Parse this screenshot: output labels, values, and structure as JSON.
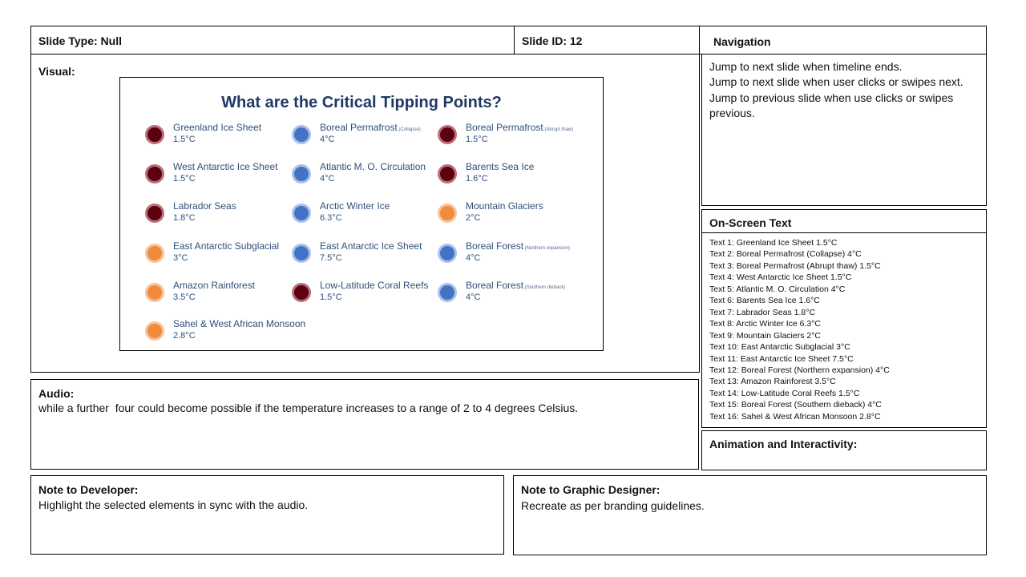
{
  "header": {
    "slide_type": "Slide Type: Null",
    "slide_id": "Slide ID: 12",
    "navigation_label": "Navigation"
  },
  "navigation": {
    "lines": [
      "Jump to next slide when timeline ends.",
      "Jump to next slide when user clicks or swipes next.",
      "Jump to previous slide when use clicks or swipes previous."
    ]
  },
  "visual": {
    "label": "Visual:",
    "title": "What are the Critical Tipping Points?",
    "items": [
      {
        "name": "Greenland Ice Sheet",
        "qualifier": "",
        "temp": "1.5°C",
        "color": "dark"
      },
      {
        "name": "Boreal Permafrost",
        "qualifier": "(Collapse)",
        "temp": "4°C",
        "color": "blue"
      },
      {
        "name": "Boreal Permafrost",
        "qualifier": "(Abrupt thaw)",
        "temp": "1.5°C",
        "color": "dark"
      },
      {
        "name": "West Antarctic Ice Sheet",
        "qualifier": "",
        "temp": "1.5°C",
        "color": "dark"
      },
      {
        "name": "Atlantic M. O. Circulation",
        "qualifier": "",
        "temp": "4°C",
        "color": "blue"
      },
      {
        "name": "Barents Sea Ice",
        "qualifier": "",
        "temp": "1.6°C",
        "color": "dark"
      },
      {
        "name": "Labrador Seas",
        "qualifier": "",
        "temp": "1.8°C",
        "color": "dark"
      },
      {
        "name": "Arctic Winter Ice",
        "qualifier": "",
        "temp": "6.3°C",
        "color": "blue"
      },
      {
        "name": "Mountain Glaciers",
        "qualifier": "",
        "temp": "2°C",
        "color": "orange"
      },
      {
        "name": "East Antarctic Subglacial",
        "qualifier": "",
        "temp": "3°C",
        "color": "orange"
      },
      {
        "name": "East Antarctic Ice Sheet",
        "qualifier": "",
        "temp": "7.5°C",
        "color": "blue"
      },
      {
        "name": "Boreal Forest",
        "qualifier": "(Northern expansion)",
        "temp": "4°C",
        "color": "blue"
      },
      {
        "name": "Amazon Rainforest",
        "qualifier": "",
        "temp": "3.5°C",
        "color": "orange"
      },
      {
        "name": "Low-Latitude Coral Reefs",
        "qualifier": "",
        "temp": "1.5°C",
        "color": "dark"
      },
      {
        "name": "Boreal Forest",
        "qualifier": "(Southern dieback)",
        "temp": "4°C",
        "color": "blue"
      },
      {
        "name": "Sahel & West African Monsoon",
        "qualifier": "",
        "temp": "2.8°C",
        "color": "orange"
      }
    ],
    "colors": {
      "dark": "#5c0010",
      "blue": "#4472c4",
      "orange": "#f08a3c",
      "title": "#1f3864"
    }
  },
  "on_screen_text": {
    "label": "On-Screen Text",
    "lines": [
      "Text 1: Greenland Ice Sheet 1.5°C",
      "Text 2: Boreal Permafrost (Collapse) 4°C",
      "Text 3: Boreal Permafrost (Abrupt thaw) 1.5°C",
      "Text 4: West Antarctic Ice Sheet 1.5°C",
      "Text 5: Atlantic M. O. Circulation 4°C",
      "Text 6: Barents Sea Ice 1.6°C",
      "Text 7: Labrador Seas 1.8°C",
      "Text 8: Arctic Winter Ice 6.3°C",
      "Text 9: Mountain Glaciers 2°C",
      "Text 10: East Antarctic Subglacial 3°C",
      "Text 11: East Antarctic Ice Sheet 7.5°C",
      "Text 12: Boreal Forest (Northern expansion) 4°C",
      "Text 13: Amazon Rainforest 3.5°C",
      "Text 14: Low-Latitude Coral Reefs 1.5°C",
      "Text 15: Boreal Forest (Southern dieback) 4°C",
      "Text 16: Sahel & West African Monsoon 2.8°C"
    ]
  },
  "audio": {
    "label": "Audio:",
    "text": "while a further  four could become possible if the temperature increases to a range of 2 to 4 degrees Celsius."
  },
  "animation": {
    "label": "Animation and Interactivity:"
  },
  "note_developer": {
    "label": "Note to Developer:",
    "text": "Highlight the selected elements in sync with the audio."
  },
  "note_designer": {
    "label": "Note to Graphic Designer:",
    "text": "Recreate as per branding guidelines."
  }
}
